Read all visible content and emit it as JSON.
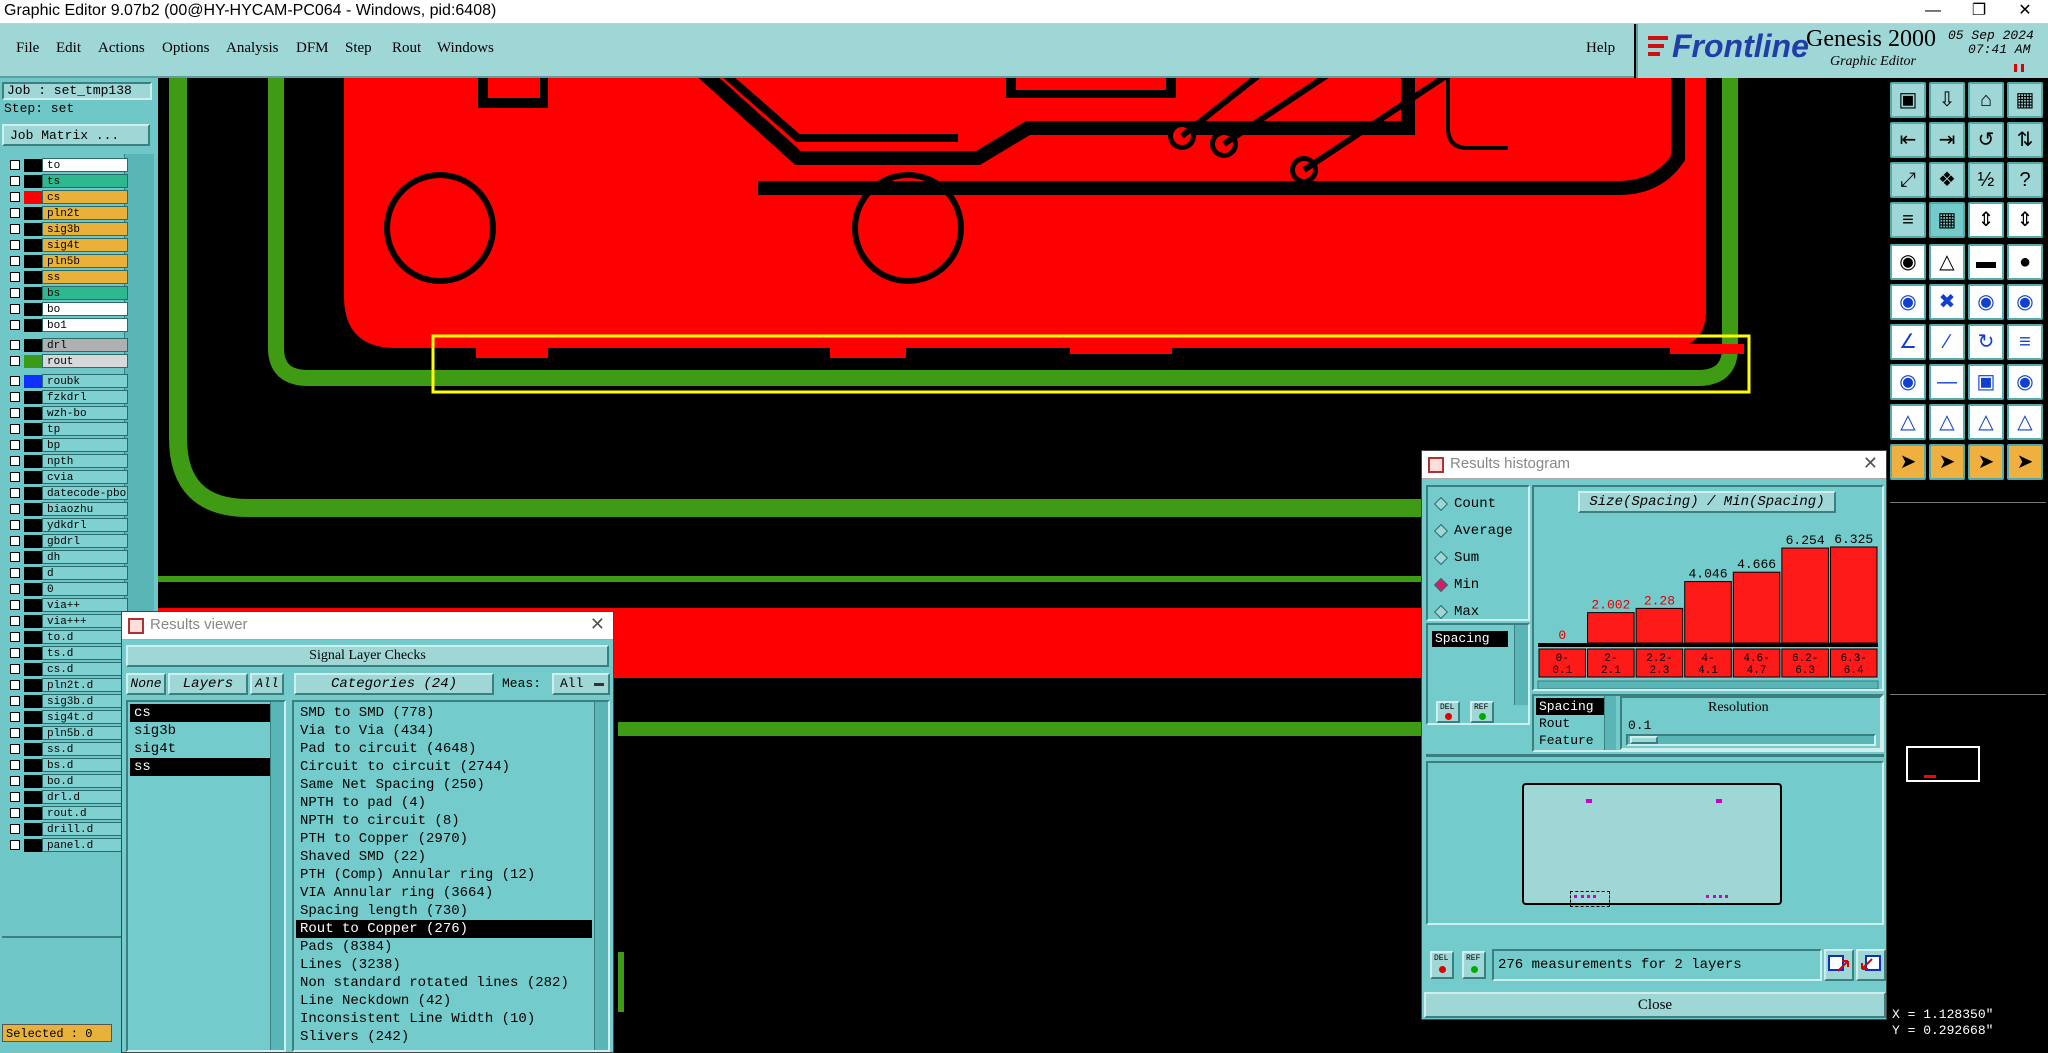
{
  "window": {
    "title": "Graphic Editor 9.07b2 (00@HY-HYCAM-PC064 - Windows, pid:6408)"
  },
  "menu": {
    "items": [
      "File",
      "Edit",
      "Actions",
      "Options",
      "Analysis",
      "DFM",
      "Step",
      "Rout",
      "Windows"
    ],
    "help": "Help"
  },
  "brand": {
    "logo": "Frontline",
    "product": "Genesis 2000",
    "subtitle": "Graphic Editor",
    "date": "05 Sep 2024",
    "time": "07:41 AM"
  },
  "job": {
    "job_label": "Job : set_tmp138",
    "step_label": "Step: set",
    "matrix_button": "Job Matrix ..."
  },
  "layers": [
    {
      "name": "to",
      "bg": "#ffffff",
      "sw": "#000000"
    },
    {
      "name": "ts",
      "bg": "#2eb88e",
      "sw": "#000000"
    },
    {
      "name": "cs",
      "bg": "#e8b23a",
      "sw": "#ff0000"
    },
    {
      "name": "pln2t",
      "bg": "#e8b23a",
      "sw": "#000000"
    },
    {
      "name": "sig3b",
      "bg": "#e8b23a",
      "sw": "#000000"
    },
    {
      "name": "sig4t",
      "bg": "#e8b23a",
      "sw": "#000000"
    },
    {
      "name": "pln5b",
      "bg": "#e8b23a",
      "sw": "#000000"
    },
    {
      "name": "ss",
      "bg": "#e8b23a",
      "sw": "#000000"
    },
    {
      "name": "bs",
      "bg": "#2eb88e",
      "sw": "#000000"
    },
    {
      "name": "bo",
      "bg": "#ffffff",
      "sw": "#000000"
    },
    {
      "name": "bo1",
      "bg": "#ffffff",
      "sw": "#000000"
    },
    {
      "name": "drl",
      "bg": "#b0b0b0",
      "sw": "#000000"
    },
    {
      "name": "rout",
      "bg": "#d8d8d8",
      "sw": "#3a9a1a"
    },
    {
      "name": "roubk",
      "bg": "#7fd0d0",
      "sw": "#1030ff"
    },
    {
      "name": "fzkdrl",
      "bg": "#7fd0d0",
      "sw": "#000000"
    },
    {
      "name": "wzh-bo",
      "bg": "#7fd0d0",
      "sw": "#000000"
    },
    {
      "name": "tp",
      "bg": "#7fd0d0",
      "sw": "#000000"
    },
    {
      "name": "bp",
      "bg": "#7fd0d0",
      "sw": "#000000"
    },
    {
      "name": "npth",
      "bg": "#7fd0d0",
      "sw": "#000000"
    },
    {
      "name": "cvia",
      "bg": "#7fd0d0",
      "sw": "#000000"
    },
    {
      "name": "datecode-pbo",
      "bg": "#7fd0d0",
      "sw": "#000000"
    },
    {
      "name": "biaozhu",
      "bg": "#7fd0d0",
      "sw": "#000000"
    },
    {
      "name": "ydkdrl",
      "bg": "#7fd0d0",
      "sw": "#000000"
    },
    {
      "name": "gbdrl",
      "bg": "#7fd0d0",
      "sw": "#000000"
    },
    {
      "name": "dh",
      "bg": "#7fd0d0",
      "sw": "#000000"
    },
    {
      "name": "d",
      "bg": "#7fd0d0",
      "sw": "#000000"
    },
    {
      "name": "0",
      "bg": "#7fd0d0",
      "sw": "#000000"
    },
    {
      "name": "via++",
      "bg": "#7fd0d0",
      "sw": "#000000"
    },
    {
      "name": "via+++",
      "bg": "#7fd0d0",
      "sw": "#000000"
    },
    {
      "name": "to.d",
      "bg": "#7fd0d0",
      "sw": "#000000"
    },
    {
      "name": "ts.d",
      "bg": "#7fd0d0",
      "sw": "#000000"
    },
    {
      "name": "cs.d",
      "bg": "#7fd0d0",
      "sw": "#000000"
    },
    {
      "name": "pln2t.d",
      "bg": "#7fd0d0",
      "sw": "#000000"
    },
    {
      "name": "sig3b.d",
      "bg": "#7fd0d0",
      "sw": "#000000"
    },
    {
      "name": "sig4t.d",
      "bg": "#7fd0d0",
      "sw": "#000000"
    },
    {
      "name": "pln5b.d",
      "bg": "#7fd0d0",
      "sw": "#000000"
    },
    {
      "name": "ss.d",
      "bg": "#7fd0d0",
      "sw": "#000000"
    },
    {
      "name": "bs.d",
      "bg": "#7fd0d0",
      "sw": "#000000"
    },
    {
      "name": "bo.d",
      "bg": "#7fd0d0",
      "sw": "#000000"
    },
    {
      "name": "drl.d",
      "bg": "#7fd0d0",
      "sw": "#000000"
    },
    {
      "name": "rout.d",
      "bg": "#7fd0d0",
      "sw": "#000000"
    },
    {
      "name": "drill.d",
      "bg": "#7fd0d0",
      "sw": "#000000"
    },
    {
      "name": "panel.d",
      "bg": "#7fd0d0",
      "sw": "#000000"
    }
  ],
  "status": {
    "selected": "Selected : 0",
    "x": "X = 1.128350\"",
    "y": "Y = 0.292668\""
  },
  "results_viewer": {
    "title": "Results viewer",
    "header": "Signal Layer Checks",
    "none_btn": "None",
    "layers_btn": "Layers",
    "all_btn": "All",
    "categories_label": "Categories (24)",
    "meas_label": "Meas:",
    "meas_value": "All",
    "layers": [
      {
        "name": "cs",
        "selected": true
      },
      {
        "name": "sig3b",
        "selected": false
      },
      {
        "name": "sig4t",
        "selected": false
      },
      {
        "name": "ss",
        "selected": true
      }
    ],
    "categories": [
      {
        "label": "SMD to SMD (778)",
        "selected": false
      },
      {
        "label": "Via to Via (434)",
        "selected": false
      },
      {
        "label": "Pad to circuit (4648)",
        "selected": false
      },
      {
        "label": "Circuit to circuit (2744)",
        "selected": false
      },
      {
        "label": "Same Net Spacing (250)",
        "selected": false
      },
      {
        "label": "NPTH to pad (4)",
        "selected": false
      },
      {
        "label": "NPTH to circuit (8)",
        "selected": false
      },
      {
        "label": "PTH to Copper (2970)",
        "selected": false
      },
      {
        "label": "Shaved SMD (22)",
        "selected": false
      },
      {
        "label": "PTH (Comp) Annular ring (12)",
        "selected": false
      },
      {
        "label": "VIA Annular ring (3664)",
        "selected": false
      },
      {
        "label": "Spacing length (730)",
        "selected": false
      },
      {
        "label": "Rout to Copper (276)",
        "selected": true
      },
      {
        "label": "Pads (8384)",
        "selected": false
      },
      {
        "label": "Lines (3238)",
        "selected": false
      },
      {
        "label": "Non standard rotated lines (282)",
        "selected": false
      },
      {
        "label": "Line Neckdown (42)",
        "selected": false
      },
      {
        "label": "Inconsistent Line Width (10)",
        "selected": false
      },
      {
        "label": "Slivers (242)",
        "selected": false
      }
    ]
  },
  "histogram": {
    "title": "Results histogram",
    "chart_title": "Size(Spacing) / Min(Spacing)",
    "modes": [
      {
        "label": "Count",
        "selected": false
      },
      {
        "label": "Average",
        "selected": false
      },
      {
        "label": "Sum",
        "selected": false
      },
      {
        "label": "Min",
        "selected": true
      },
      {
        "label": "Max",
        "selected": false
      }
    ],
    "measure_list": [
      "Spacing"
    ],
    "type_list": [
      "Spacing",
      "Rout",
      "Feature"
    ],
    "resolution_label": "Resolution",
    "resolution_value": "0.1",
    "summary": "276 measurements for 2 layers",
    "close_label": "Close",
    "del_label": "DEL",
    "ref_label": "REF"
  },
  "chart_data": {
    "type": "bar",
    "title": "Size(Spacing) / Min(Spacing)",
    "xlabel": "",
    "ylabel": "",
    "categories": [
      "0-\n0.1",
      "2-\n2.1",
      "2.2-\n2.3",
      "4-\n4.1",
      "4.6-\n4.7",
      "6.2-\n6.3",
      "6.3-\n6.4"
    ],
    "value_labels": [
      "0",
      "2.002",
      "2.28",
      "4.046",
      "4.666",
      "6.254",
      "6.325"
    ],
    "values": [
      0,
      2.002,
      2.28,
      4.046,
      4.666,
      6.254,
      6.325
    ],
    "bar_color": "#ff1a1a",
    "ylim": [
      0,
      6.325
    ],
    "grid": false,
    "legend": "none"
  },
  "colors": {
    "copper": "#ff0000",
    "rout": "#3f9a14",
    "panel": "#73cbcb",
    "highlight": "#ffff00"
  }
}
